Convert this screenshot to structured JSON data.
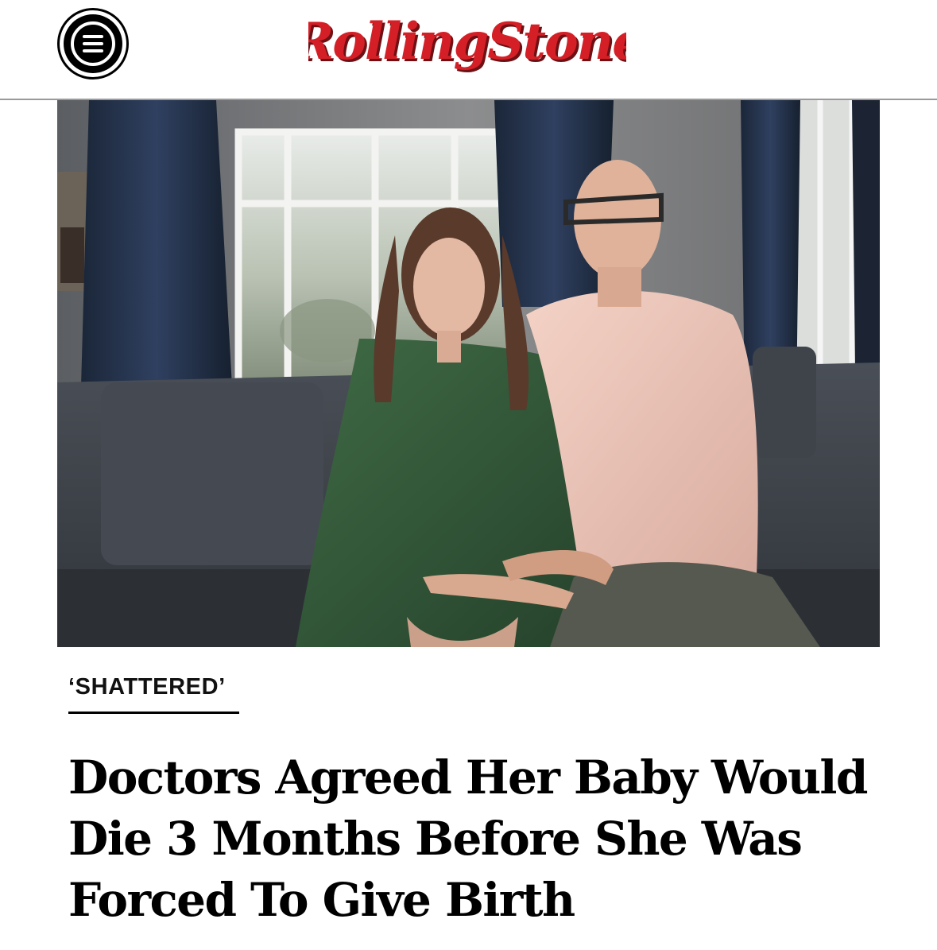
{
  "header": {
    "logo_text": "RollingStone",
    "menu_icon": "hamburger-menu-icon"
  },
  "hero": {
    "image": "photo of a woman in a green dress and a bald man with glasses in a pink shirt seated on a grey sofa"
  },
  "article": {
    "kicker": "‘SHATTERED’",
    "headline": "Doctors Agreed Her Baby Would Die 3 Months Before She Was Forced To Give Birth"
  },
  "colors": {
    "brand_red": "#d41f26",
    "text": "#000000",
    "divider": "#9a9a9a"
  }
}
